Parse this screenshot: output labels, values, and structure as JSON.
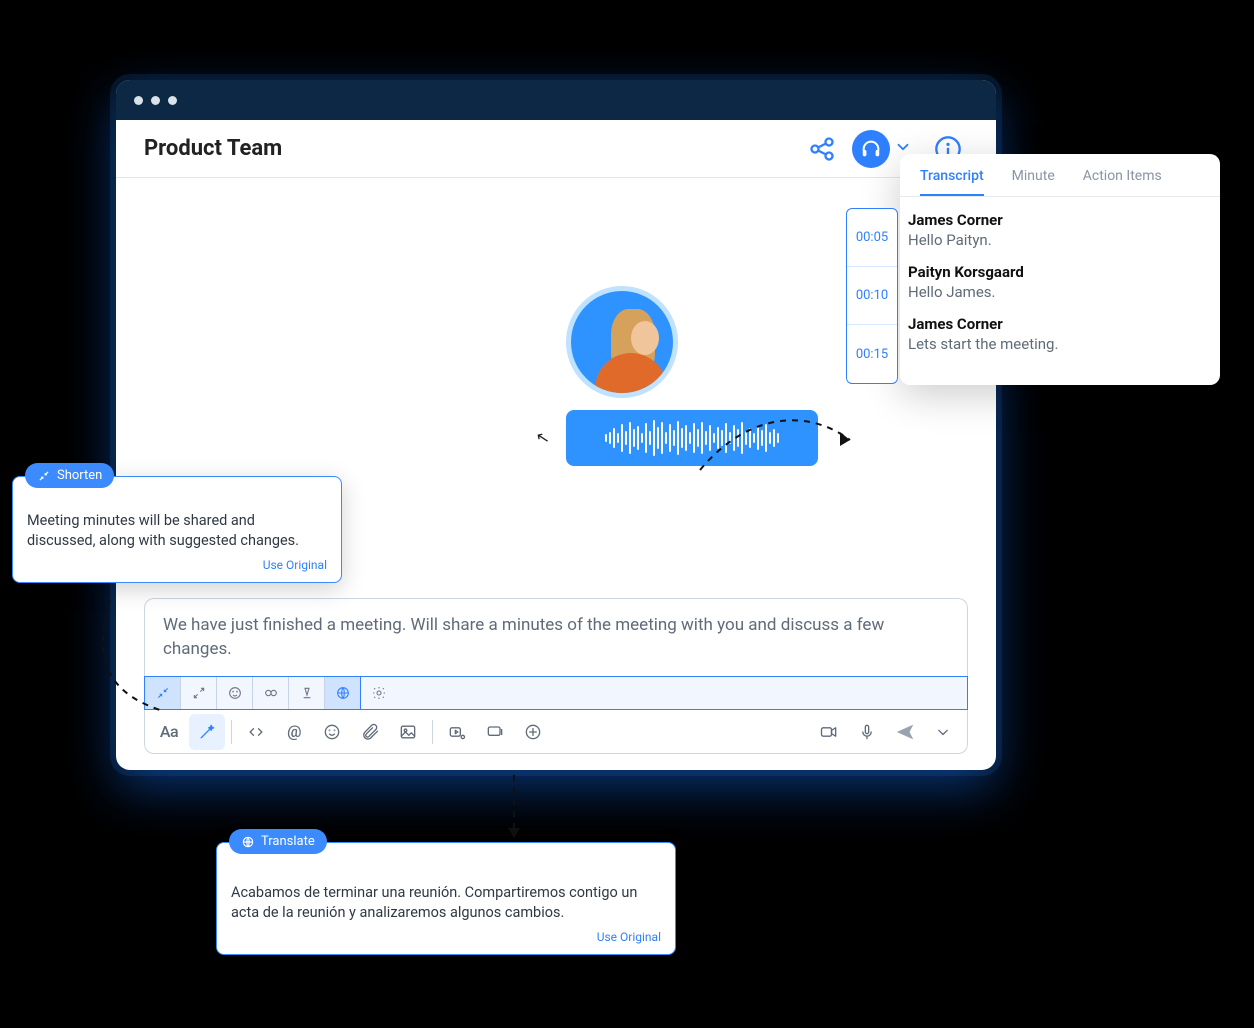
{
  "header": {
    "title": "Product Team"
  },
  "compose": {
    "text": "We have just finished a meeting. Will share a minutes of the meeting with you and discuss a few changes."
  },
  "aiTools": {
    "shorten": "shorten",
    "expand": "expand",
    "tone": "tone",
    "continue": "continue",
    "style": "style",
    "translate": "translate",
    "settings": "settings"
  },
  "transcript": {
    "tabs": [
      "Transcript",
      "Minute",
      "Action Items"
    ],
    "times": [
      "00:05",
      "00:10",
      "00:15"
    ],
    "entries": [
      {
        "speaker": "James Corner",
        "text": "Hello Paityn."
      },
      {
        "speaker": "Paityn Korsgaard",
        "text": "Hello James."
      },
      {
        "speaker": "James Corner",
        "text": "Lets start the meeting."
      }
    ]
  },
  "callouts": {
    "shorten": {
      "label": "Shorten",
      "body": "Meeting minutes will be shared and discussed, along with suggested changes.",
      "link": "Use Original"
    },
    "translate": {
      "label": "Translate",
      "body": "Acabamos de terminar una reunión. Compartiremos contigo un acta de la reunión y analizaremos algunos cambios.",
      "link": "Use Original"
    }
  }
}
